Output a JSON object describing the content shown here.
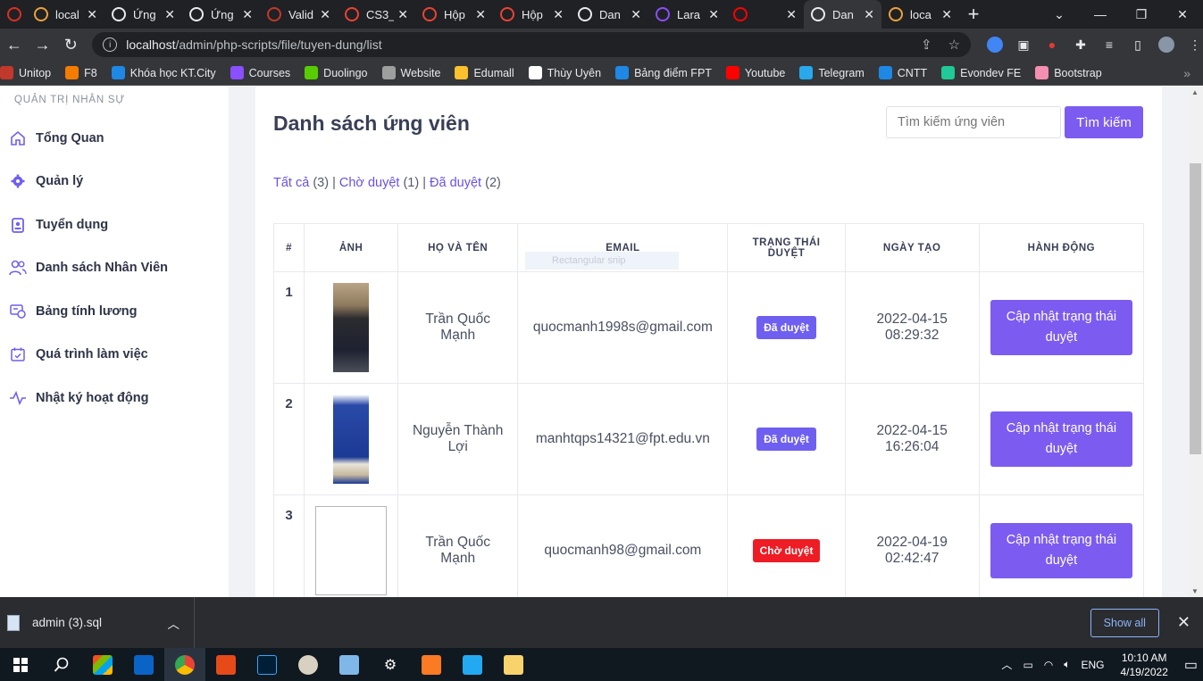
{
  "browser": {
    "tabs": [
      {
        "title": "",
        "color": "#d93025",
        "active": false
      },
      {
        "title": "local",
        "color": "#e9a23b",
        "active": false
      },
      {
        "title": "Ứng",
        "color": "#e8eaed",
        "active": false
      },
      {
        "title": "Ứng",
        "color": "#e8eaed",
        "active": false
      },
      {
        "title": "Valid",
        "color": "#c0392b",
        "active": false
      },
      {
        "title": "CS3_",
        "color": "#ea4335",
        "active": false
      },
      {
        "title": "Hộp",
        "color": "#ea4335",
        "active": false
      },
      {
        "title": "Hộp",
        "color": "#ea4335",
        "active": false
      },
      {
        "title": "Dan",
        "color": "#e8eaed",
        "active": false
      },
      {
        "title": "Lara",
        "color": "#8a4fff",
        "active": false
      },
      {
        "title": "",
        "color": "#ff0000",
        "active": false
      },
      {
        "title": "Dan",
        "color": "#e8eaed",
        "active": true
      },
      {
        "title": "loca",
        "color": "#e9a23b",
        "active": false
      }
    ],
    "url_host": "localhost",
    "url_path": "/admin/php-scripts/file/tuyen-dung/list",
    "bookmarks": [
      {
        "label": "Unitop",
        "color": "#c0392b"
      },
      {
        "label": "F8",
        "color": "#f57c00"
      },
      {
        "label": "Khóa học KT.City",
        "color": "#1e88e5"
      },
      {
        "label": "Courses",
        "color": "#8a4fff"
      },
      {
        "label": "Duolingo",
        "color": "#58cc02"
      },
      {
        "label": "Website",
        "color": "#9e9e9e"
      },
      {
        "label": "Edumall",
        "color": "#fbc02d"
      },
      {
        "label": "Thùy Uyên",
        "color": "#ffffff"
      },
      {
        "label": "Bảng điểm FPT",
        "color": "#1e88e5"
      },
      {
        "label": "Youtube",
        "color": "#ff0000"
      },
      {
        "label": "Telegram",
        "color": "#29a9eb"
      },
      {
        "label": "CNTT",
        "color": "#1e88e5"
      },
      {
        "label": "Evondev FE",
        "color": "#20c997"
      },
      {
        "label": "Bootstrap",
        "color": "#f48fb1"
      }
    ]
  },
  "sidebar": {
    "heading": "QUẢN TRỊ NHÂN SỰ",
    "items": [
      {
        "label": "Tổng Quan",
        "icon": "home-icon"
      },
      {
        "label": "Quản lý",
        "icon": "gear-icon"
      },
      {
        "label": "Tuyển dụng",
        "icon": "id-card-icon"
      },
      {
        "label": "Danh sách Nhân Viên",
        "icon": "users-icon"
      },
      {
        "label": "Bảng tính lương",
        "icon": "payroll-icon"
      },
      {
        "label": "Quá trình làm việc",
        "icon": "calendar-check-icon"
      },
      {
        "label": "Nhật ký hoạt động",
        "icon": "activity-icon"
      }
    ]
  },
  "main": {
    "title": "Danh sách ứng viên",
    "search_placeholder": "Tìm kiếm ứng viên",
    "search_button": "Tìm kiếm",
    "filters": {
      "all_label": "Tất cả",
      "all_count": "(3)",
      "pending_label": "Chờ duyệt",
      "pending_count": "(1)",
      "approved_label": "Đã duyệt",
      "approved_count": "(2)",
      "separator": " | "
    },
    "ghost_text": "Rectangular snip",
    "table": {
      "headers": [
        "#",
        "ẢNH",
        "HỌ VÀ TÊN",
        "EMAIL",
        "TRẠNG THÁI DUYỆT",
        "NGÀY TẠO",
        "HÀNH ĐỘNG"
      ],
      "rows": [
        {
          "index": "1",
          "name": "Trần Quốc Mạnh",
          "email": "quocmanh1998s@gmail.com",
          "status": "Đã duyệt",
          "status_color": "#6f5ff0",
          "date": "2022-04-15",
          "time": "08:29:32",
          "action": "Cập nhật trạng thái duyệt"
        },
        {
          "index": "2",
          "name": "Nguyễn Thành Lợi",
          "email": "manhtqps14321@fpt.edu.vn",
          "status": "Đã duyệt",
          "status_color": "#6f5ff0",
          "date": "2022-04-15",
          "time": "16:26:04",
          "action": "Cập nhật trạng thái duyệt"
        },
        {
          "index": "3",
          "name": "Trần Quốc Mạnh",
          "email": "quocmanh98@gmail.com",
          "status": "Chờ duyệt",
          "status_color": "#ee1c24",
          "date": "2022-04-19",
          "time": "02:42:47",
          "action": "Cập nhật trạng thái duyệt"
        }
      ]
    }
  },
  "download_bar": {
    "file_name": "admin (3).sql",
    "show_all": "Show all"
  },
  "taskbar": {
    "language": "ENG",
    "time": "10:10 AM",
    "date": "4/19/2022"
  }
}
